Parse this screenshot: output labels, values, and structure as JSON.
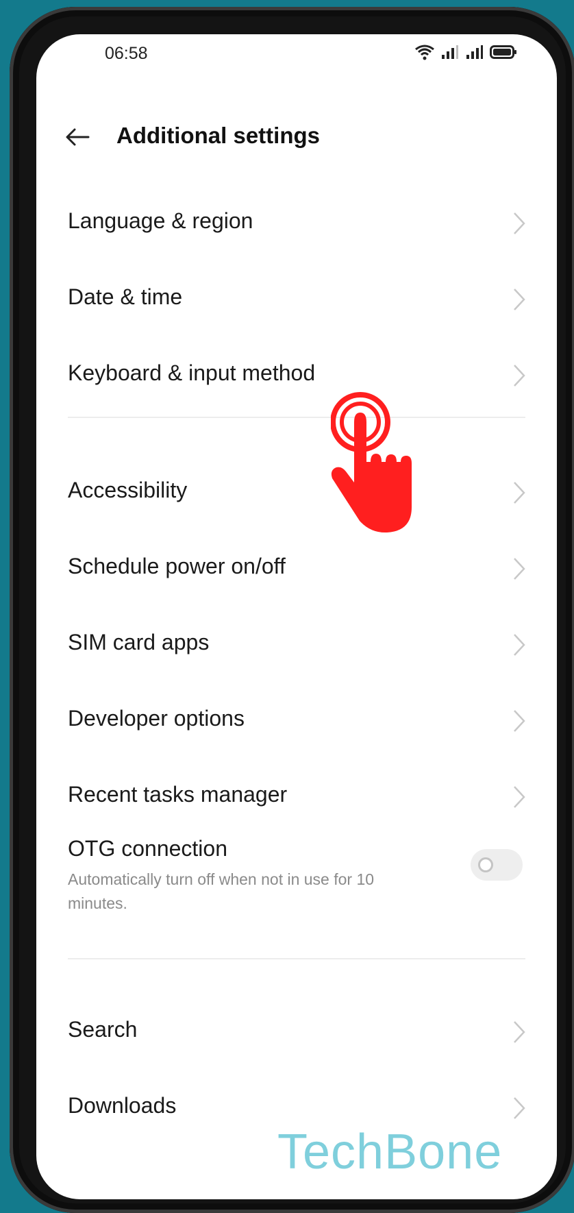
{
  "status_bar": {
    "time": "06:58",
    "icons": [
      "wifi-icon",
      "signal-icon",
      "signal-icon",
      "battery-icon"
    ]
  },
  "header": {
    "title": "Additional settings",
    "back_icon": "arrow-left-icon"
  },
  "items_group1": [
    {
      "label": "Language & region"
    },
    {
      "label": "Date & time"
    },
    {
      "label": "Keyboard & input method"
    }
  ],
  "items_group2": [
    {
      "label": "Accessibility"
    },
    {
      "label": "Schedule power on/off"
    },
    {
      "label": "SIM card apps"
    },
    {
      "label": "Developer options"
    },
    {
      "label": "Recent tasks manager"
    }
  ],
  "otg": {
    "label": "OTG connection",
    "description": "Automatically turn off when not in use for 10 minutes.",
    "enabled": false
  },
  "items_group3": [
    {
      "label": "Search"
    },
    {
      "label": "Downloads"
    }
  ],
  "overlay": {
    "tap_icon": "tap-hand-icon",
    "tap_color": "#ff1f1f"
  },
  "watermark": "TechBone",
  "colors": {
    "background": "#137a8c",
    "watermark": "#7fcfdc"
  }
}
